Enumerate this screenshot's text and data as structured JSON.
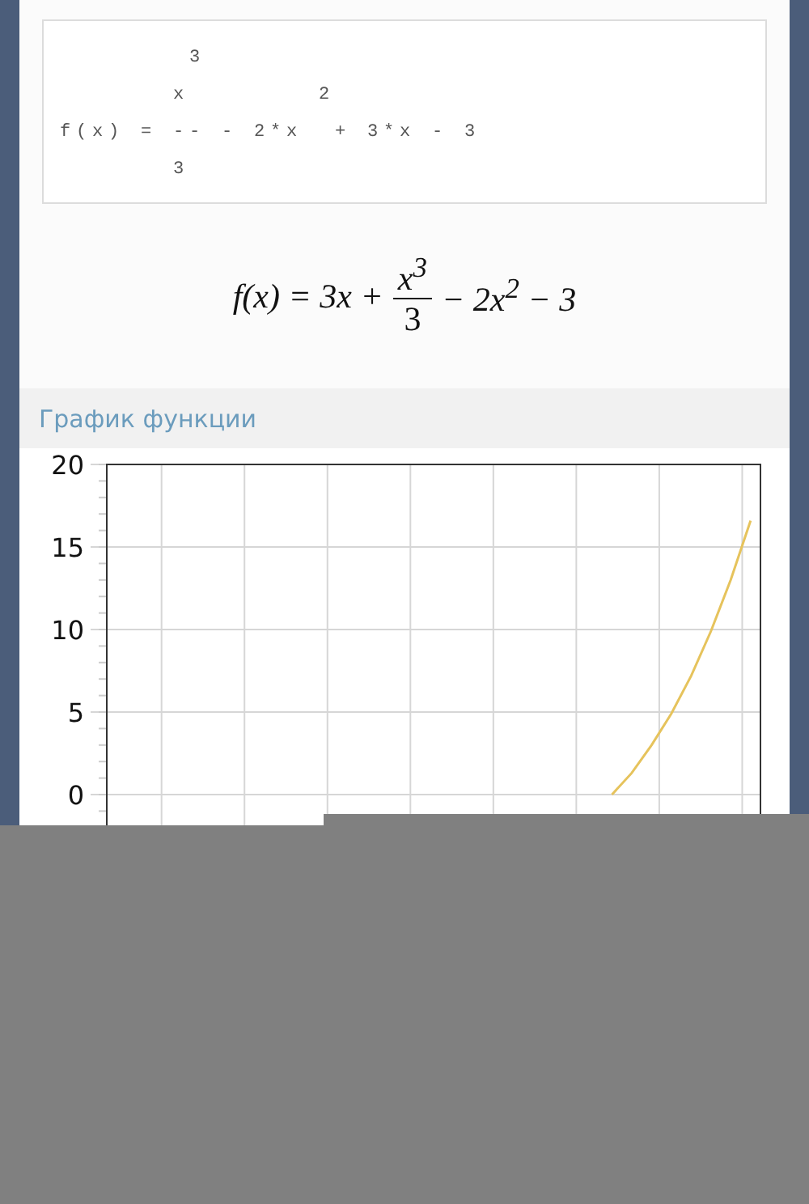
{
  "ascii_formula": {
    "lines": [
      "        3",
      "       x        2",
      "f(x) = -- - 2*x  + 3*x - 3",
      "       3"
    ]
  },
  "formula": {
    "before": "f(x) = 3x +",
    "numerator": "x$^{3}$",
    "denominator": "3",
    "after": "− 2x$^{2}$ − 3"
  },
  "section": {
    "title": "График функции"
  },
  "chart_data": {
    "type": "line",
    "grid": true,
    "ylim": [
      -2,
      20
    ],
    "yticks": [
      0,
      5,
      10,
      15,
      20
    ],
    "categories": [
      null,
      null,
      null,
      null,
      null,
      null,
      null,
      null,
      null,
      null,
      null,
      null,
      null,
      null,
      null,
      null,
      null,
      null,
      null,
      null,
      null,
      null,
      null,
      null,
      null,
      null,
      null,
      null,
      null,
      null,
      null,
      null,
      null
    ],
    "series": [
      {
        "color": "#e6c35c",
        "values": [
          null,
          null,
          null,
          null,
          null,
          null,
          null,
          null,
          null,
          null,
          null,
          null,
          null,
          null,
          null,
          null,
          null,
          null,
          null,
          null,
          null,
          null,
          null,
          null,
          null,
          0,
          1.3,
          3,
          4.9,
          7.2,
          9.9,
          13,
          16.6
        ]
      }
    ]
  }
}
